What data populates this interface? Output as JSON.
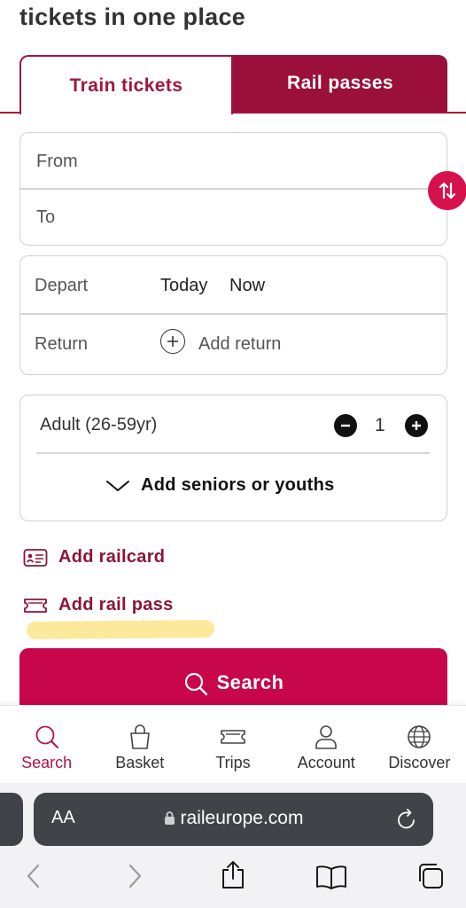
{
  "headline": "tickets in one place",
  "tabs": [
    {
      "label": "Train tickets",
      "active": true
    },
    {
      "label": "Rail passes",
      "active": false
    }
  ],
  "route": {
    "from_placeholder": "From",
    "to_placeholder": "To"
  },
  "dates": {
    "depart_label": "Depart",
    "depart_day": "Today",
    "depart_time": "Now",
    "return_label": "Return",
    "add_return": "Add return"
  },
  "passengers": {
    "type": "Adult (26-59yr)",
    "count": "1",
    "add_more": "Add seniors or youths"
  },
  "links": {
    "add_railcard": "Add railcard",
    "add_rail_pass": "Add rail pass"
  },
  "search_button": "Search",
  "bottom_nav": [
    {
      "label": "Search",
      "icon": "search-icon",
      "active": true
    },
    {
      "label": "Basket",
      "icon": "basket-icon",
      "active": false
    },
    {
      "label": "Trips",
      "icon": "ticket-icon",
      "active": false
    },
    {
      "label": "Account",
      "icon": "person-icon",
      "active": false
    },
    {
      "label": "Discover",
      "icon": "globe-icon",
      "active": false
    }
  ],
  "browser": {
    "aa_label": "AA",
    "url": "raileurope.com"
  },
  "colors": {
    "brand": "#9b0f3b",
    "accent": "#c8064a",
    "highlight": "#fde58a"
  }
}
